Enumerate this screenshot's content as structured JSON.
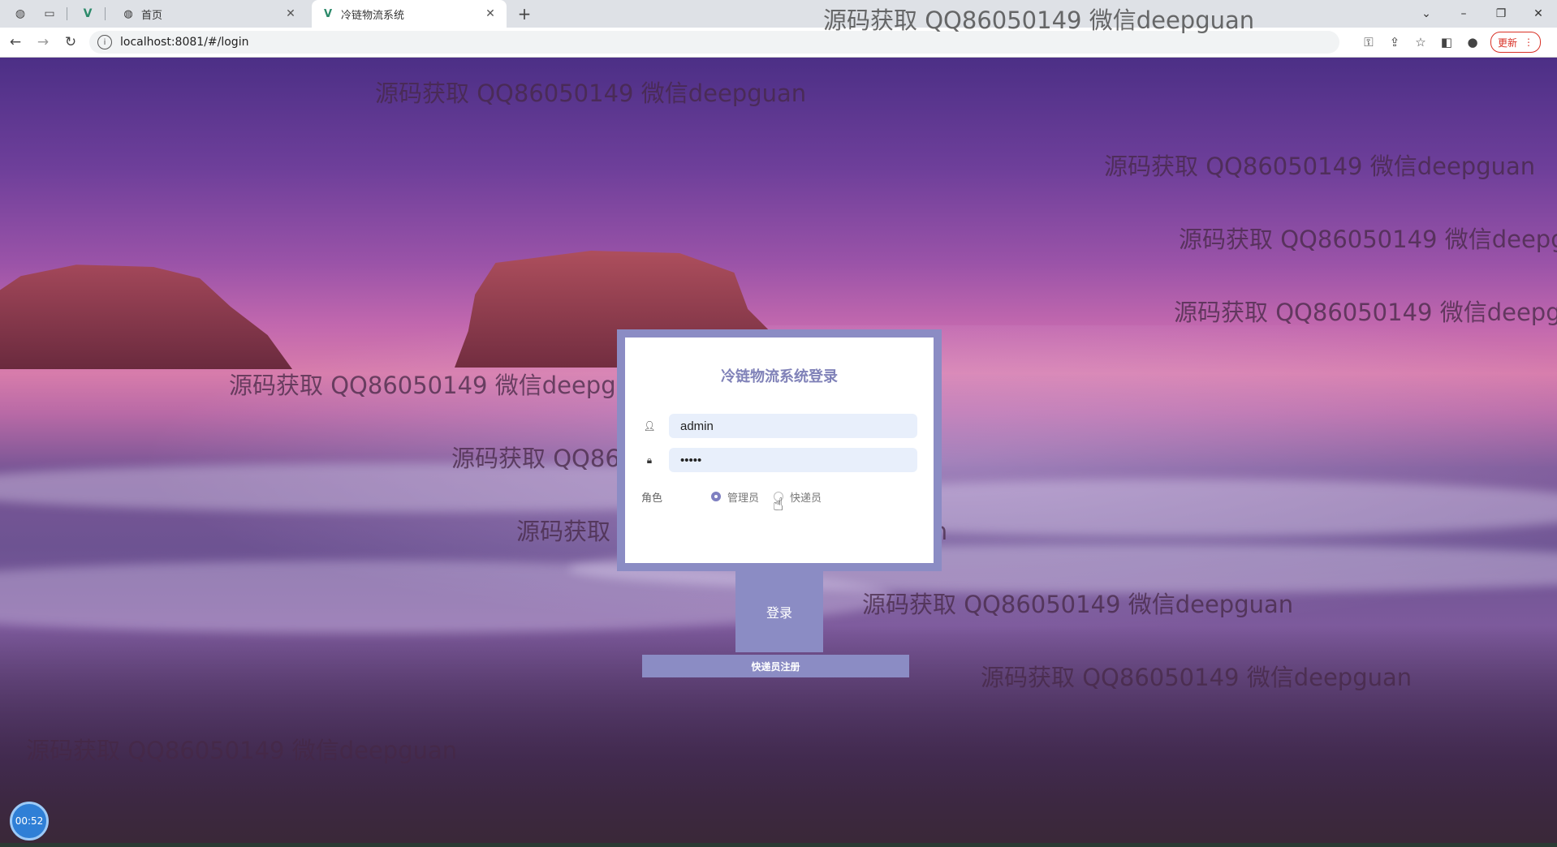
{
  "browser": {
    "tabs": [
      {
        "title": "首页",
        "active": false,
        "icon": "globe-icon"
      },
      {
        "title": "冷链物流系统",
        "active": true,
        "icon": "vue-logo-icon"
      }
    ],
    "new_tab_symbol": "+",
    "url": "localhost:8081/#/login",
    "update_label": "更新",
    "window_controls": [
      "⌄",
      "–",
      "❐",
      "✕"
    ]
  },
  "login": {
    "title": "冷链物流系统登录",
    "username_value": "admin",
    "password_value": "•••••",
    "role_label": "角色",
    "roles": [
      {
        "label": "管理员",
        "selected": true
      },
      {
        "label": "快递员",
        "selected": false
      }
    ],
    "login_button": "登录",
    "register_button": "快递员注册"
  },
  "watermark_text": "源码获取 QQ86050149 微信deepguan",
  "timer": "00:52",
  "colors": {
    "accent": "#8b8cc4",
    "title": "#8082b8",
    "input_bg": "#e8effb"
  }
}
